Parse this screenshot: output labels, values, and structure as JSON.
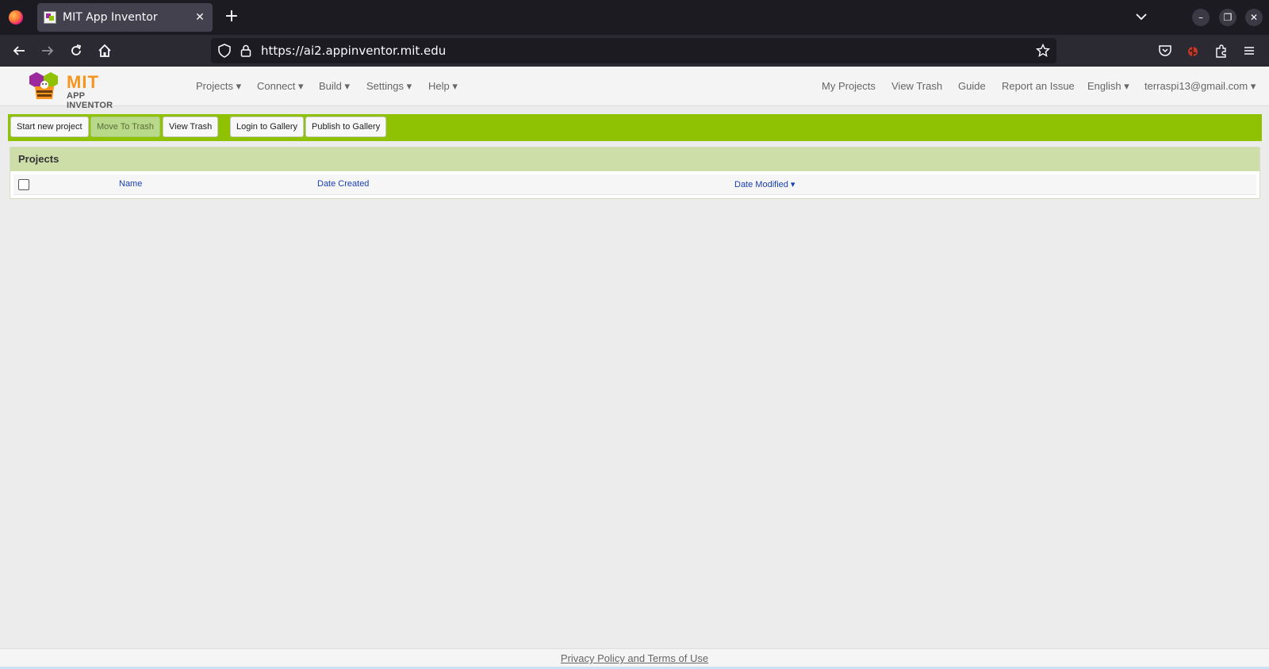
{
  "browser": {
    "tab_title": "MIT App Inventor",
    "tab_close": "✕",
    "new_tab": "+",
    "url": "https://ai2.appinventor.mit.edu",
    "min": "–",
    "restore": "❐",
    "close": "✕"
  },
  "header": {
    "logo_mit": "MIT",
    "logo_app_inventor": "APP INVENTOR",
    "menus": [
      "Projects ▾",
      "Connect ▾",
      "Build ▾",
      "Settings ▾",
      "Help ▾"
    ],
    "right_links": [
      "My Projects",
      "View Trash",
      "Guide",
      "Report an Issue",
      "English ▾",
      "terraspi13@gmail.com ▾"
    ]
  },
  "toolbar": {
    "start_new_project": "Start new project",
    "move_to_trash": "Move To Trash",
    "view_trash": "View Trash",
    "login_to_gallery": "Login to Gallery",
    "publish_to_gallery": "Publish to Gallery"
  },
  "projects": {
    "title": "Projects",
    "columns": {
      "name": "Name",
      "date_created": "Date Created",
      "date_modified": "Date Modified ▾"
    }
  },
  "footer": {
    "privacy": "Privacy Policy and Terms of Use"
  },
  "colors": {
    "toolbar_green": "#8fc202",
    "panel_header": "#cddea9",
    "logo_orange": "#f7941d",
    "link_blue": "#1a3fb3"
  }
}
